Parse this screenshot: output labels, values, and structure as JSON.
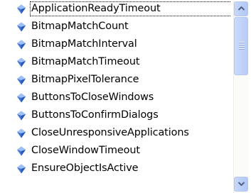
{
  "list": {
    "items": [
      {
        "label": "ApplicationReadyTimeout",
        "selected": true
      },
      {
        "label": "BitmapMatchCount"
      },
      {
        "label": "BitmapMatchInterval"
      },
      {
        "label": "BitmapMatchTimeout"
      },
      {
        "label": "BitmapPixelTolerance"
      },
      {
        "label": "ButtonsToCloseWindows"
      },
      {
        "label": "ButtonsToConfirmDialogs"
      },
      {
        "label": "CloseUnresponsiveApplications"
      },
      {
        "label": "CloseWindowTimeout"
      },
      {
        "label": "EnsureObjectIsActive"
      }
    ],
    "item_icon": "property-icon"
  },
  "scrollbar": {
    "up_icon": "arrow-up-icon",
    "down_icon": "arrow-down-icon"
  },
  "colors": {
    "icon_blue": "#3f74d8",
    "icon_light": "#9ec0f5",
    "scroll_blue": "#c2d3f8",
    "arrow": "#4d6185"
  }
}
